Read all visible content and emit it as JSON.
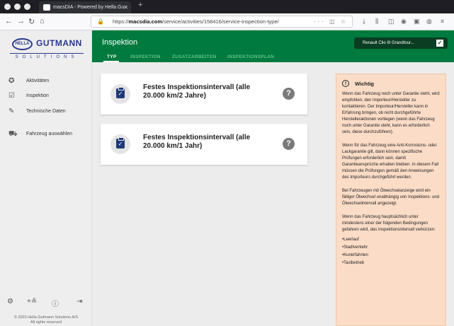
{
  "browser": {
    "tab_title": "macsDIA - Powered by Hella Gu",
    "tab_close": "✕",
    "new_tab": "+",
    "url_prefix": "https://",
    "url_domain": "macsdia.com",
    "url_path": "/service/activities/158416/service-inspection-type/",
    "url_actions": "··· ◫ ☆"
  },
  "sidebar": {
    "logo_hella": "HELLA",
    "logo_gutmann": "GUTMANN",
    "logo_solutions": "SOLUTIONS",
    "items": [
      {
        "label": "Aktivitäten",
        "icon": "✪"
      },
      {
        "label": "Inspektion",
        "icon": "☑"
      },
      {
        "label": "Technische Daten",
        "icon": "✎"
      },
      {
        "label": "Fahrzeug auswählen",
        "icon": "⛟"
      }
    ],
    "footer_icons": [
      "⚙",
      "+≗",
      "ⓘ",
      "⇥"
    ],
    "copyright_line1": "© 2020 Hella Gutmann Solutions A/S",
    "copyright_line2": "All rights reserved"
  },
  "header": {
    "title": "Inspektion",
    "vehicle_button": "Renault Clio III Grandtour...",
    "tabs": [
      "TYP",
      "INSPEKTION",
      "ZUSATZARBEITEN",
      "INSPEKTIONSPLAN"
    ]
  },
  "cards": [
    {
      "title_line1": "Festes Inspektionsintervall (alle",
      "title_line2": "20.000 km/2 Jahre)"
    },
    {
      "title_line1": "Festes Inspektionsintervall (alle",
      "title_line2": "20.000 km/1 Jahr)"
    }
  ],
  "info": {
    "title": "Wichtig",
    "paragraphs": [
      "Wenn das Fahrzeug noch unter Garantie steht, wird empfohlen, den Importeur/Hersteller zu kontaktieren. Der Importeur/Hersteller kann in Erfahrung bringen, ob nicht durchgeführte Herstelleraktionen vorliegen (wenn das Fahrzeug noch unter Garantie steht, kann es erforderlich sein, diese durchzuführen).",
      "Wenn für das Fahrzeug eine Anti-Korrosions- oder Lackgarantie gilt, dann können spezifische Prüfungen erforderlich sein, damit Garantieansprüche erhalten bleiben. In diesem Fall müssen die Prüfungen gemäß den Anweisungen des Importeurs durchgeführt werden.",
      "Bei Fahrzeugen mit Ölwechselanzeige wird ein fälliger Ölwechsel unabhängig von Inspektions- und Ölwechselintervall angezeigt.",
      "Wenn das Fahrzeug hauptsächlich unter mindestens einer der folgenden Bedingungen gefahren wird, das Inspektionsintervall verkürzen:"
    ],
    "list": [
      "Leerlauf",
      "Stadtverkehr",
      "Kurierfahrten",
      "Taxibetrieb"
    ]
  },
  "colors": {
    "header_green": "#007a3e",
    "info_bg": "#fbdcc7",
    "icon_blue": "#1f3a78"
  }
}
